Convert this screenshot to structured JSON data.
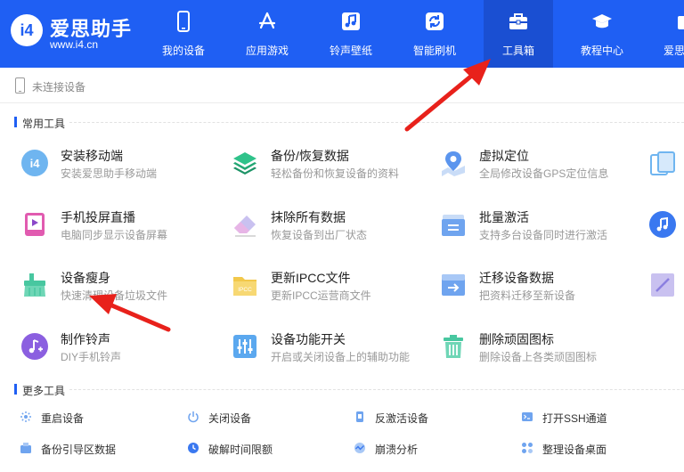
{
  "brand": {
    "name": "爱思助手",
    "url": "www.i4.cn",
    "badge": "i4"
  },
  "nav": [
    {
      "label": "我的设备",
      "icon": "phone-icon"
    },
    {
      "label": "应用游戏",
      "icon": "app-store-icon"
    },
    {
      "label": "铃声壁纸",
      "icon": "music-note-icon"
    },
    {
      "label": "智能刷机",
      "icon": "refresh-icon"
    },
    {
      "label": "工具箱",
      "icon": "toolbox-icon",
      "active": true
    },
    {
      "label": "教程中心",
      "icon": "graduation-cap-icon"
    },
    {
      "label": "爱思",
      "icon": "store-icon"
    }
  ],
  "device_status": "未连接设备",
  "sections": {
    "common": "常用工具",
    "more": "更多工具"
  },
  "tools": [
    {
      "title": "安装移动端",
      "desc": "安装爱思助手移动端",
      "icon": "i4-app-icon"
    },
    {
      "title": "备份/恢复数据",
      "desc": "轻松备份和恢复设备的资料",
      "icon": "layers-icon"
    },
    {
      "title": "虚拟定位",
      "desc": "全局修改设备GPS定位信息",
      "icon": "location-pin-icon"
    },
    {
      "title": "",
      "desc": "",
      "icon": "tablet-icon"
    },
    {
      "title": "手机投屏直播",
      "desc": "电脑同步显示设备屏幕",
      "icon": "screen-mirror-icon"
    },
    {
      "title": "抹除所有数据",
      "desc": "恢复设备到出厂状态",
      "icon": "eraser-icon"
    },
    {
      "title": "批量激活",
      "desc": "支持多台设备同时进行激活",
      "icon": "batch-activate-icon"
    },
    {
      "title": "",
      "desc": "",
      "icon": "music-circle-icon"
    },
    {
      "title": "设备瘦身",
      "desc": "快速清理设备垃圾文件",
      "icon": "broom-icon"
    },
    {
      "title": "更新IPCC文件",
      "desc": "更新IPCC运营商文件",
      "icon": "ipcc-folder-icon"
    },
    {
      "title": "迁移设备数据",
      "desc": "把资料迁移至新设备",
      "icon": "migrate-icon"
    },
    {
      "title": "",
      "desc": "",
      "icon": "edit-icon"
    },
    {
      "title": "制作铃声",
      "desc": "DIY手机铃声",
      "icon": "ringtone-icon"
    },
    {
      "title": "设备功能开关",
      "desc": "开启或关闭设备上的辅助功能",
      "icon": "sliders-icon"
    },
    {
      "title": "删除顽固图标",
      "desc": "删除设备上各类顽固图标",
      "icon": "trash-icon"
    }
  ],
  "more_tools": [
    {
      "label": "重启设备",
      "icon": "restart-icon"
    },
    {
      "label": "关闭设备",
      "icon": "power-icon"
    },
    {
      "label": "反激活设备",
      "icon": "deactivate-icon"
    },
    {
      "label": "打开SSH通道",
      "icon": "ssh-icon"
    },
    {
      "label": "备份引导区数据",
      "icon": "boot-backup-icon"
    },
    {
      "label": "破解时间限额",
      "icon": "clock-icon"
    },
    {
      "label": "崩溃分析",
      "icon": "crash-analysis-icon"
    },
    {
      "label": "整理设备桌面",
      "icon": "grid-icon"
    }
  ],
  "colors": {
    "brand_blue": "#1f5ff3",
    "nav_active": "#1a4fd2",
    "annotation_red": "#e8211b"
  }
}
